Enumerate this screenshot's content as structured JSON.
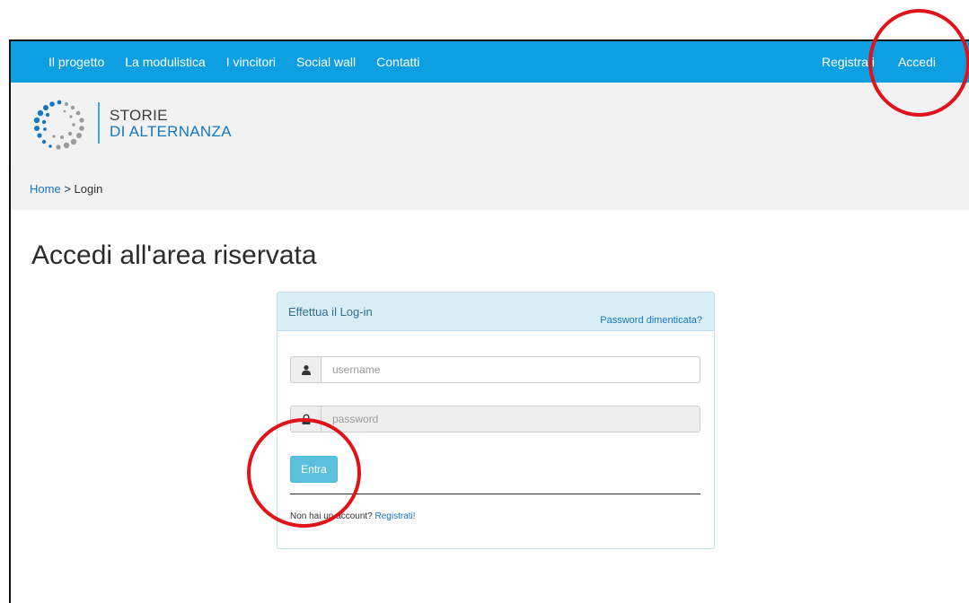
{
  "nav": {
    "left_items": [
      "Il progetto",
      "La modulistica",
      "I vincitori",
      "Social wall",
      "Contatti"
    ],
    "register_label": "Registrati",
    "login_label": "Accedi"
  },
  "brand": {
    "line1": "STORIE",
    "line2": "DI ALTERNANZA"
  },
  "breadcrumb": {
    "home": "Home",
    "separator": ">",
    "current": "Login"
  },
  "page": {
    "title": "Accedi all'area riservata"
  },
  "login_panel": {
    "heading": "Effettua il Log-in",
    "forgot_password": "Password dimenticata?",
    "username_placeholder": "username",
    "password_placeholder": "password",
    "submit_label": "Entra",
    "no_account_text": "Non hai un account?",
    "register_link": "Registrati!"
  },
  "colors": {
    "nav_bg": "#0e9fe3",
    "brand_blue": "#1576c2",
    "panel_heading_bg": "#d9edf7",
    "button_info": "#5bc0de",
    "annotation_red": "#e0121a"
  },
  "icons": {
    "username_addon": "user-icon",
    "password_addon": "lock-icon"
  }
}
